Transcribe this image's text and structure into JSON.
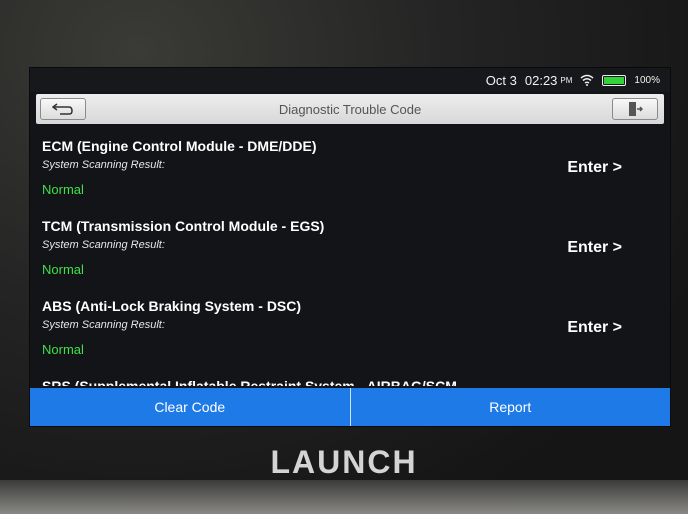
{
  "status_bar": {
    "date": "Oct 3",
    "time": "02:23",
    "meridiem": "PM",
    "battery": "100%",
    "battery_color": "#33d23a"
  },
  "header": {
    "title": "Diagnostic Trouble Code",
    "back_icon": "back-arrow-icon",
    "exit_icon": "exit-door-icon"
  },
  "modules": [
    {
      "name": "ECM (Engine Control Module - DME/DDE)",
      "result_label": "System Scanning Result:",
      "result": "Normal",
      "action": "Enter >"
    },
    {
      "name": "TCM (Transmission Control Module - EGS)",
      "result_label": "System Scanning Result:",
      "result": "Normal",
      "action": "Enter >"
    },
    {
      "name": "ABS (Anti-Lock Braking System - DSC)",
      "result_label": "System Scanning Result:",
      "result": "Normal",
      "action": "Enter >"
    },
    {
      "name": "SRS (Supplemental Inflatable Restraint System - AIRBAG/SCM",
      "result_label": "",
      "result": "",
      "action": ""
    }
  ],
  "footer": {
    "clear_code": "Clear Code",
    "report": "Report",
    "accent_color": "#1e7ae6"
  },
  "brand": "LAUNCH"
}
